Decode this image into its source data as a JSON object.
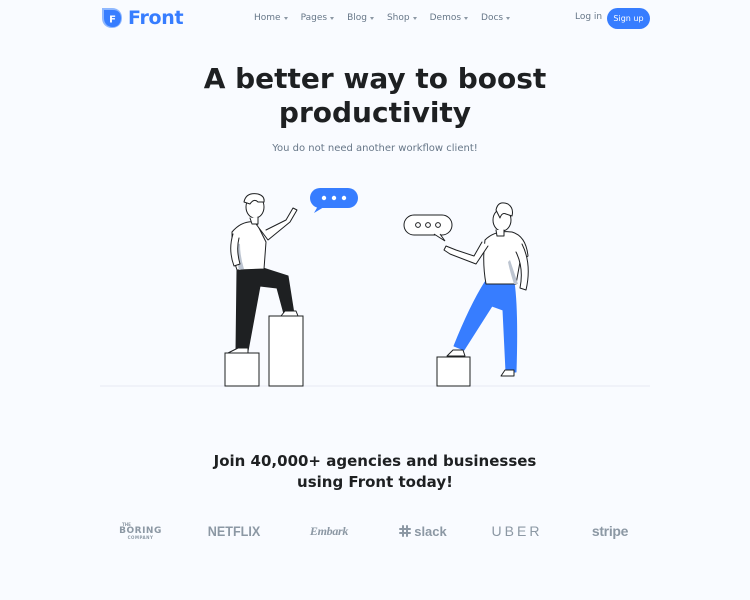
{
  "header": {
    "logo_text": "Front",
    "nav": [
      {
        "label": "Home"
      },
      {
        "label": "Pages"
      },
      {
        "label": "Blog"
      },
      {
        "label": "Shop"
      },
      {
        "label": "Demos"
      },
      {
        "label": "Docs"
      }
    ],
    "login_label": "Log in",
    "signup_label": "Sign up"
  },
  "hero": {
    "title_line1": "A better way to boost",
    "title_line2": "productivity",
    "subtitle": "You do not need another workflow client!"
  },
  "brands": {
    "title_line1": "Join 40,000+ agencies and businesses",
    "title_line2": "using Front today!",
    "logos": [
      {
        "name": "boring-company",
        "the": "THE",
        "main": "BORING",
        "sub": "COMPANY"
      },
      {
        "name": "netflix",
        "label": "NETFLIX"
      },
      {
        "name": "embark",
        "label": "Embark"
      },
      {
        "name": "slack",
        "label": "slack"
      },
      {
        "name": "uber",
        "label": "UBER"
      },
      {
        "name": "stripe",
        "label": "stripe"
      }
    ]
  },
  "colors": {
    "accent": "#377dff",
    "background": "#f9fbff",
    "text_muted": "#677788",
    "logo_gray": "#8c98a4"
  }
}
